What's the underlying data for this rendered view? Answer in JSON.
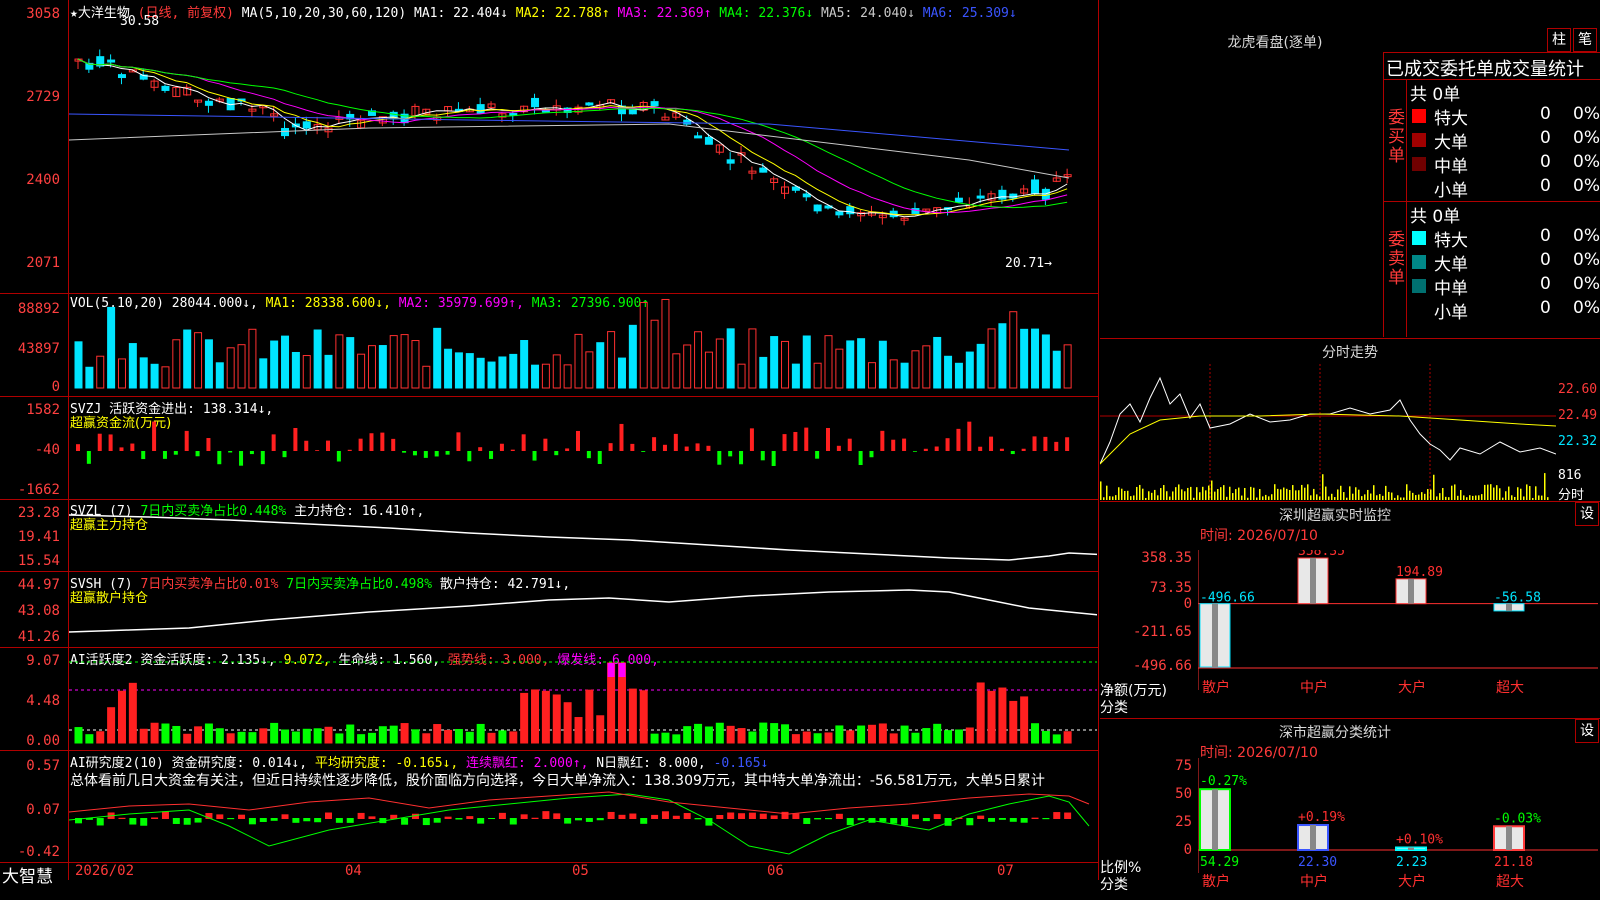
{
  "stock": {
    "name": "★大洋生物",
    "mode": "(日线, 前复权)",
    "ma_label": "MA(5,10,20,30,60,120)",
    "ma": [
      {
        "text": "MA1: 22.404↓",
        "color": "#ffffff"
      },
      {
        "text": "MA2: 22.788↑",
        "color": "#ffff00"
      },
      {
        "text": "MA3: 22.369↑",
        "color": "#ff00ff"
      },
      {
        "text": "MA4: 22.376↓",
        "color": "#00ff00"
      },
      {
        "text": "MA5: 24.040↓",
        "color": "#c8c8c8"
      },
      {
        "text": "MA6: 25.309↓",
        "color": "#3a55ff"
      }
    ],
    "high_mark": "30.58",
    "low_mark": "20.71→",
    "price_axis": [
      "3058",
      "2729",
      "2400",
      "2071"
    ]
  },
  "vol": {
    "label": "VOL(5,10,20)",
    "value": "28044.000↓,",
    "ma1": "MA1: 28338.600↓,",
    "ma2": "MA2: 35979.699↑,",
    "ma3": "MA3: 27396.900↑",
    "axis": [
      "88892",
      "43897",
      "0"
    ]
  },
  "svzj": {
    "label": "SVZJ",
    "text": "活跃资金进出: 138.314↓,",
    "sub": "超赢资金流(万元)",
    "axis": [
      "1582",
      "-40",
      "-1662"
    ]
  },
  "svzl": {
    "label": "SVZL (7)",
    "text1": "7日内买卖净占比0.448%",
    "text2": "主力持仓: 16.410↑,",
    "sub": "超赢主力持仓",
    "axis": [
      "23.28",
      "19.41",
      "15.54"
    ]
  },
  "svsh": {
    "label": "SVSH (7)",
    "text1": "7日内买卖净占比0.01%",
    "text2": "7日内买卖净占比0.498%",
    "text3": "散户持仓: 42.791↓,",
    "sub": "超赢散户持仓",
    "axis": [
      "44.97",
      "43.08",
      "41.26"
    ]
  },
  "ai1": {
    "label": "AI活跃度2",
    "t1": "资金活跃度: 2.135↓,",
    "t2": "9.072,",
    "t3": "生命线: 1.560,",
    "t4": "强势线: 3.000,",
    "t5": "爆发线: 6.000,",
    "axis": [
      "9.07",
      "4.48",
      "0.00"
    ]
  },
  "ai2": {
    "label": "AI研究度2(10)",
    "t1": "资金研究度: 0.014↓,",
    "t2": "平均研究度: -0.165↓,",
    "t3": "连续飘红: 2.000↑,",
    "t4": "N日飘红: 8.000,",
    "t5": "-0.165↓",
    "summary": "总体看前几日大资金有关注，但近日持续性逐步降低，股价面临方向选择，今日大单净流入：138.309万元，其中特大单净流出：-56.581万元，大单5日累计",
    "axis": [
      "0.57",
      "0.07",
      "-0.42"
    ]
  },
  "dates": [
    "2026/02",
    "04",
    "05",
    "06",
    "07"
  ],
  "brand": "大智慧",
  "dragon": {
    "title": "龙虎看盘(逐单)",
    "btn1": "柱",
    "btn2": "笔",
    "subtitle": "已成交委托单成交量统计",
    "buy_label": "委买单",
    "sell_label": "委卖单",
    "buy_total": "共 0单",
    "sell_total": "共 0单",
    "buy_rows": [
      {
        "name": "特大",
        "val": "0",
        "pct": "0%",
        "color": "#ff0000"
      },
      {
        "name": "大单",
        "val": "0",
        "pct": "0%",
        "color": "#a00000"
      },
      {
        "name": "中单",
        "val": "0",
        "pct": "0%",
        "color": "#700000"
      },
      {
        "name": "小单",
        "val": "0",
        "pct": "0%",
        "color": "#000000"
      }
    ],
    "sell_rows": [
      {
        "name": "特大",
        "val": "0",
        "pct": "0%",
        "color": "#00ffff"
      },
      {
        "name": "大单",
        "val": "0",
        "pct": "0%",
        "color": "#008888"
      },
      {
        "name": "中单",
        "val": "0",
        "pct": "0%",
        "color": "#007070"
      },
      {
        "name": "小单",
        "val": "0",
        "pct": "0%",
        "color": "#000000"
      }
    ]
  },
  "intraday": {
    "title": "分时走势",
    "axis": [
      "22.60",
      "22.49",
      "22.32"
    ],
    "vol": "816",
    "unit": "分时"
  },
  "monitor": {
    "title": "深圳超赢实时监控",
    "btn": "设",
    "time": "时间: 2026/07/10",
    "axis": [
      "358.35",
      "73.35",
      "0",
      "-211.65",
      "-496.66"
    ],
    "ylabel": "净额(万元)",
    "xlabel": "分类",
    "bars": [
      {
        "cat": "散户",
        "value": -496.66,
        "label": "-496.66"
      },
      {
        "cat": "中户",
        "value": 358.35,
        "label": "358.35"
      },
      {
        "cat": "大户",
        "value": 194.89,
        "label": "194.89"
      },
      {
        "cat": "超大",
        "value": -56.58,
        "label": "-56.58"
      }
    ]
  },
  "classify": {
    "title": "深市超赢分类统计",
    "btn": "设",
    "time": "时间: 2026/07/10",
    "axis": [
      "75",
      "50",
      "25",
      "0"
    ],
    "ylabel": "比例%",
    "xlabel": "分类",
    "bars": [
      {
        "cat": "散户",
        "value": 54.29,
        "label": "54.29",
        "delta": "-0.27%",
        "color": "#00ff00"
      },
      {
        "cat": "中户",
        "value": 22.3,
        "label": "22.30",
        "delta": "+0.19%",
        "color": "#3a55ff"
      },
      {
        "cat": "大户",
        "value": 2.23,
        "label": "2.23",
        "delta": "+0.10%",
        "color": "#00ffff"
      },
      {
        "cat": "超大",
        "value": 21.18,
        "label": "21.18",
        "delta": "-0.03%",
        "color": "#ff3a3a"
      }
    ]
  }
}
